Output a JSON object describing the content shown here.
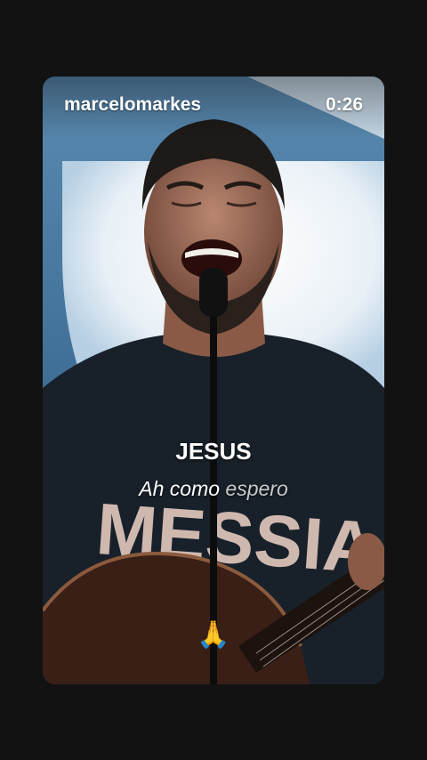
{
  "story": {
    "username": "marcelomarkes",
    "time": "0:26",
    "lyric_line1": "JESUS",
    "lyric_line2_highlight": "Ah como ",
    "lyric_line2_rest": "espero",
    "shirt_text": "MESSIA",
    "reaction_emoji": "🙏"
  },
  "colors": {
    "page_background": "#121212",
    "backdrop_light": "#eef3f7",
    "backdrop_blue": "#4d7fa6",
    "shirt": "#18212a",
    "shirt_print": "#e3c9bd"
  }
}
